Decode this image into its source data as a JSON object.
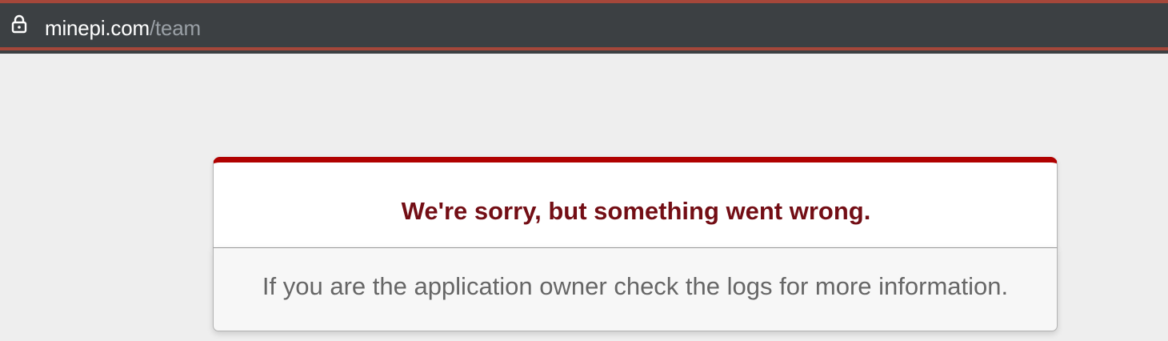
{
  "address_bar": {
    "lock_icon": "lock-icon",
    "domain": "minepi.com",
    "path": "/team",
    "colors": {
      "background": "#3c4043",
      "accent_stripe": "#a5473a",
      "domain_text": "#ffffff",
      "path_text": "#9aa0a6"
    }
  },
  "error_dialog": {
    "title": "We're sorry, but something went wrong.",
    "message": "If you are the application owner check the logs for more information.",
    "colors": {
      "top_border": "#b00100",
      "title_text": "#730e15",
      "message_text": "#666666",
      "page_background": "#eeeeee"
    }
  }
}
